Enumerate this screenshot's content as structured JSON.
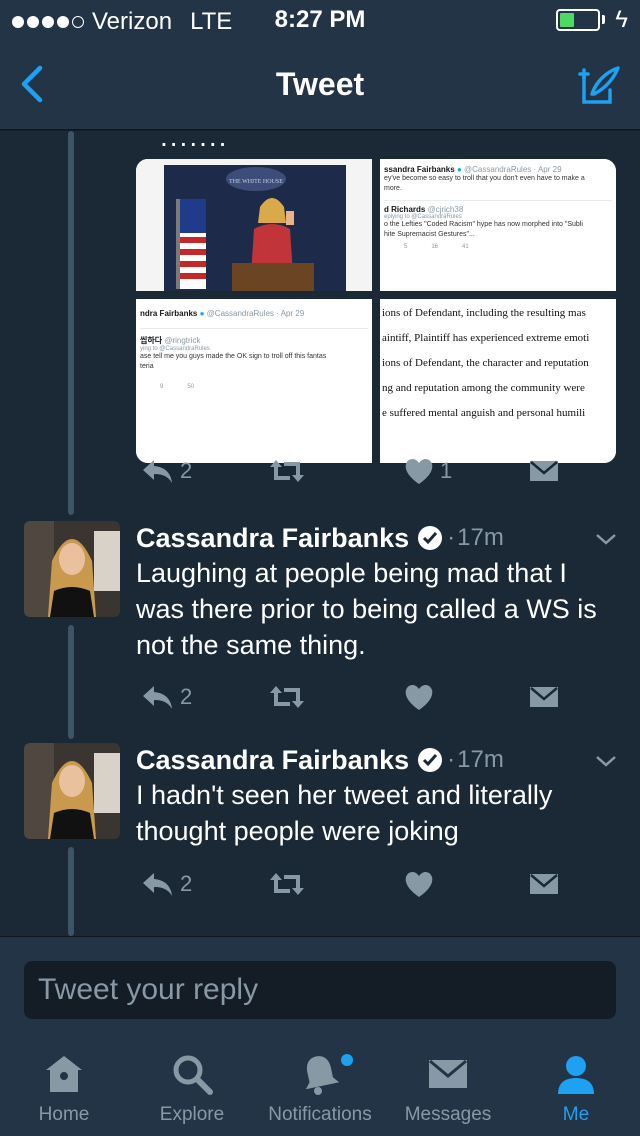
{
  "status_bar": {
    "carrier": "Verizon",
    "network": "LTE",
    "time": "8:27 PM",
    "signal_bars": 4,
    "battery_level": 0.3,
    "charging": true
  },
  "nav": {
    "title": "Tweet",
    "back_icon": "chevron-left-icon",
    "compose_icon": "compose-tweet-icon"
  },
  "previous_tweet": {
    "quote_text": ".......",
    "media": {
      "top_right_embed": {
        "name": "ssandra Fairbanks",
        "handle": "@CassandraRules · Apr 29",
        "text_lines": [
          "ey've become so easy to troll that you don't even have to make a",
          "more."
        ],
        "reply_name": "d Richards",
        "reply_handle": "@cjrich38",
        "reply_to": "eplying to @CassandraRules",
        "reply_lines": [
          "o the Lefties \"Coded Racism\" hype has now morphed into \"Subli",
          "hite Supremacist Gestures\"..."
        ],
        "counts": [
          "5",
          "16",
          "41"
        ]
      },
      "bottom_left_embed": {
        "name": "ndra Fairbanks",
        "handle": "@CassandraRules · Apr 29",
        "reply_name": "씹하다",
        "reply_handle": "@ringtrick",
        "reply_to": "ying to @CassandraRules",
        "text_lines": [
          "ase tell me you guys made the OK sign  to troll off this fantas",
          "teria"
        ],
        "counts": [
          "9",
          "50"
        ]
      },
      "bottom_right_doc": {
        "lines": [
          "ions of Defendant, including the resulting mas",
          "aintiff, Plaintiff has experienced extreme emoti",
          "ions of Defendant, the character and reputation",
          "ng and reputation among the community were",
          "e suffered mental anguish and personal humili"
        ]
      }
    },
    "actions": {
      "replies": "2",
      "retweets": "",
      "likes": "1"
    }
  },
  "tweets": [
    {
      "name": "Cassandra Fairbanks",
      "separator": "·",
      "time": "17m",
      "text": "Laughing at people being mad that I was there prior to being called a WS is not the same thing.",
      "actions": {
        "replies": "2",
        "retweets": "",
        "likes": ""
      }
    },
    {
      "name": "Cassandra Fairbanks",
      "separator": "·",
      "time": "17m",
      "text": "I hadn't seen her tweet and literally thought people were joking",
      "actions": {
        "replies": "2",
        "retweets": "",
        "likes": ""
      }
    }
  ],
  "reply": {
    "placeholder": "Tweet your reply"
  },
  "tabs": [
    {
      "label": "Home",
      "icon": "home-icon"
    },
    {
      "label": "Explore",
      "icon": "search-icon"
    },
    {
      "label": "Notifications",
      "icon": "bell-icon",
      "badge": true
    },
    {
      "label": "Messages",
      "icon": "envelope-icon"
    },
    {
      "label": "Me",
      "icon": "person-icon",
      "active": true
    }
  ],
  "colors": {
    "background": "#1b2836",
    "bars": "#243447",
    "accent": "#1da1f2",
    "muted": "#8899a6",
    "thread_line": "#3d5466",
    "battery": "#4cd964"
  }
}
